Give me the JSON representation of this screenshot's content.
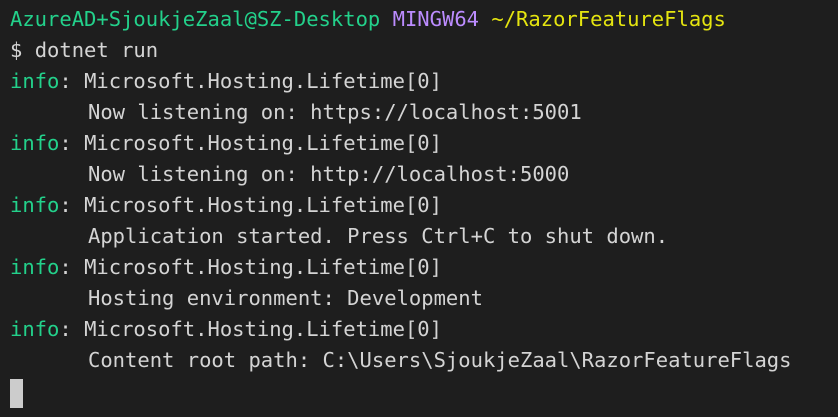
{
  "prompt": {
    "user_host": "AzureAD+SjoukjeZaal@SZ-Desktop",
    "shell": "MINGW64",
    "path": "~/RazorFeatureFlags"
  },
  "command": {
    "symbol": "$",
    "text": "dotnet run"
  },
  "log_entries": [
    {
      "level": "info",
      "source": "Microsoft.Hosting.Lifetime[0]",
      "message": "Now listening on: https://localhost:5001"
    },
    {
      "level": "info",
      "source": "Microsoft.Hosting.Lifetime[0]",
      "message": "Now listening on: http://localhost:5000"
    },
    {
      "level": "info",
      "source": "Microsoft.Hosting.Lifetime[0]",
      "message": "Application started. Press Ctrl+C to shut down."
    },
    {
      "level": "info",
      "source": "Microsoft.Hosting.Lifetime[0]",
      "message": "Hosting environment: Development"
    },
    {
      "level": "info",
      "source": "Microsoft.Hosting.Lifetime[0]",
      "message": "Content root path: C:\\Users\\SjoukjeZaal\\RazorFeatureFlags"
    }
  ],
  "colors": {
    "background": "#1e1e1e",
    "text": "#d4d4d4",
    "prompt_user": "#23d18b",
    "prompt_shell": "#bc8cff",
    "prompt_path": "#e5e510",
    "log_level": "#23d18b",
    "cursor": "#cccccc"
  }
}
